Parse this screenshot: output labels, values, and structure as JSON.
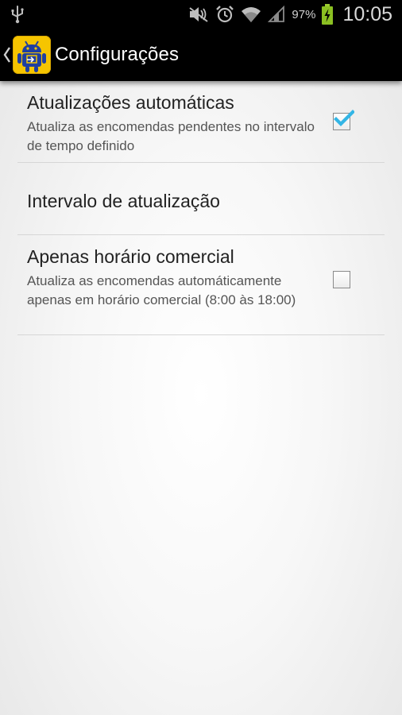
{
  "status_bar": {
    "battery_percent": "97%",
    "time": "10:05",
    "icons": [
      "usb-icon",
      "mute-icon",
      "alarm-icon",
      "wifi-icon",
      "signal-icon",
      "battery-charging-icon"
    ]
  },
  "action_bar": {
    "title": "Configurações",
    "app_icon": "android-app-icon"
  },
  "preferences": [
    {
      "title": "Atualizações automáticas",
      "summary": "Atualiza as encomendas pendentes no intervalo de tempo definido",
      "checked": true
    },
    {
      "title": "Intervalo de atualização"
    },
    {
      "title": "Apenas horário comercial",
      "summary": "Atualiza as encomendas automáticamente apenas em horário comercial (8:00 às 18:00)",
      "checked": false
    }
  ],
  "colors": {
    "accent_check": "#33b5e5",
    "app_icon_bg": "#f6c500",
    "android_blue": "#1f3fa0"
  }
}
